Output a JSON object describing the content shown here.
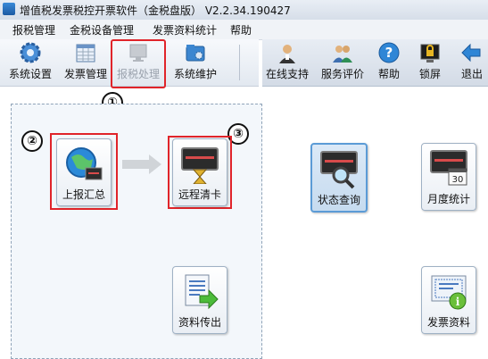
{
  "window": {
    "title": "增值税发票税控开票软件（金税盘版） V2.2.34.190427"
  },
  "menu": {
    "items": [
      "报税管理",
      "金税设备管理",
      "发票资料统计",
      "帮助"
    ]
  },
  "toolbar": {
    "left": [
      {
        "label": "系统设置",
        "icon": "gear-icon",
        "enabled": true
      },
      {
        "label": "发票管理",
        "icon": "invoice-table-icon",
        "enabled": true
      },
      {
        "label": "报税处理",
        "icon": "monitor-icon",
        "enabled": false
      },
      {
        "label": "系统维护",
        "icon": "folder-gear-icon",
        "enabled": true
      }
    ],
    "right": [
      {
        "label": "在线支持",
        "icon": "support-person-icon"
      },
      {
        "label": "服务评价",
        "icon": "people-icon"
      },
      {
        "label": "帮助",
        "icon": "help-icon"
      },
      {
        "label": "锁屏",
        "icon": "lock-icon"
      },
      {
        "label": "退出",
        "icon": "exit-arrow-icon"
      }
    ]
  },
  "annotations": {
    "n1": "①",
    "n2": "②",
    "n3": "③"
  },
  "main": {
    "buttons": {
      "upload_summary": {
        "label": "上报汇总",
        "icon": "globe-upload-icon"
      },
      "remote_clear": {
        "label": "远程清卡",
        "icon": "hourglass-screen-icon"
      },
      "status_query": {
        "label": "状态查询",
        "icon": "magnifier-screen-icon"
      },
      "monthly_stats": {
        "label": "月度统计",
        "icon": "calendar-30-icon",
        "day": "30"
      },
      "data_export": {
        "label": "资料传出",
        "icon": "document-arrow-icon"
      },
      "invoice_data": {
        "label": "发票资料",
        "icon": "invoice-info-icon"
      }
    }
  },
  "colors": {
    "highlight": "#e0242a",
    "selected_border": "#5b9bd6"
  }
}
